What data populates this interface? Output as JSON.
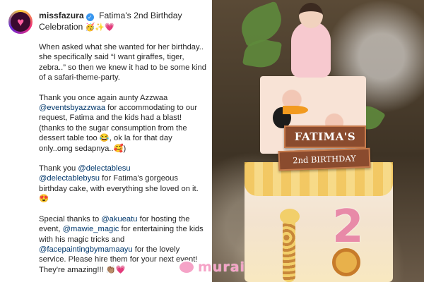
{
  "post": {
    "username": "missfazura",
    "verified_mark": "✓",
    "title": "Fatima's 2nd Birthday Celebration",
    "title_emoji": "🥳✨💗"
  },
  "caption": {
    "p1": "When asked what she wanted for her birthday.. she specifically said “I want giraffes, tiger, zebra..” so then we knew it had to be some kind of a safari-theme-party.",
    "p2_a": "Thank you once again aunty Azzwaa ",
    "p2_mention": "@eventsbyazzwaa",
    "p2_b": " for accommodating to our request, Fatima and the kids had a blast! (thanks to the sugar consumption from the dessert table too 😂, ok la for that day only..omg sedapnya..🥰)",
    "p3_a": "Thank you ",
    "p3_mention1": "@delectablesu",
    "p3_mention2": "@delectablebysu",
    "p3_b": " for Fatima's gorgeous birthday cake, with everything she loved on it. 😍",
    "p4_a": "Special thanks to ",
    "p4_mention1": "@akueatu",
    "p4_b": " for hosting the event, ",
    "p4_mention2": "@mawie_magic",
    "p4_c": " for entertaining the kids with his magic tricks and ",
    "p4_mention3": "@facepaintingbymamaayu",
    "p4_d": " for the lovely service. Please hire them for your next event! They're amazing!!! 👏🏽💗"
  },
  "photo": {
    "sign_name": "FATIMA'S",
    "sign_sub": "2nd BIRTHDAY",
    "cake_number": "2"
  },
  "watermark": {
    "text": "murai"
  },
  "colors": {
    "mention": "#00376b",
    "verified": "#3897f0",
    "sign_wood": "#8a4b2e",
    "watermark": "#f5a3c7"
  }
}
